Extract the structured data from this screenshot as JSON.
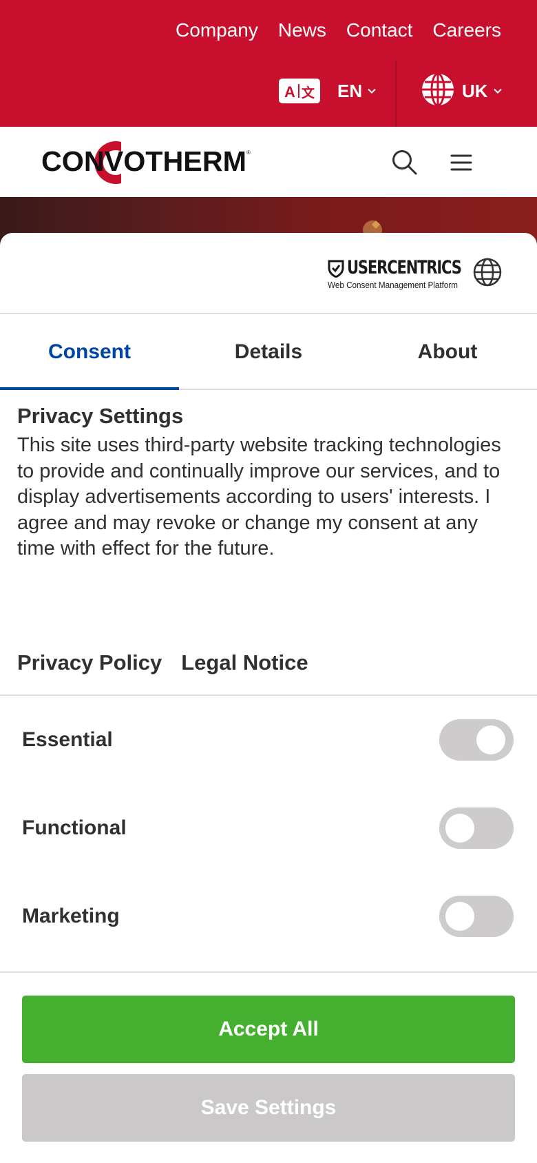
{
  "topnav": {
    "links": [
      "Company",
      "News",
      "Contact",
      "Careers"
    ],
    "language_label": "EN",
    "region_label": "UK"
  },
  "brand": {
    "logo_text": "CONVOTHERM"
  },
  "consent": {
    "provider_name": "USERCENTRICS",
    "provider_tagline": "Web Consent Management Platform",
    "tabs": [
      {
        "label": "Consent",
        "active": true
      },
      {
        "label": "Details",
        "active": false
      },
      {
        "label": "About",
        "active": false
      }
    ],
    "title": "Privacy Settings",
    "description": "This site uses third-party website tracking technologies to provide and continually improve our services, and to display advertisements according to users' interests. I agree and may revoke or change my consent at any time with effect for the future.",
    "links": [
      "Privacy Policy",
      "Legal Notice"
    ],
    "categories": [
      {
        "label": "Essential",
        "enabled": true
      },
      {
        "label": "Functional",
        "enabled": false
      },
      {
        "label": "Marketing",
        "enabled": false
      }
    ],
    "accept_label": "Accept All",
    "save_label": "Save Settings"
  },
  "colors": {
    "brand_red": "#c8102e",
    "tab_active": "#0045a5",
    "accept_green": "#45b02f",
    "save_gray": "#cac8c8",
    "toggle_gray": "#cdcbcb"
  }
}
